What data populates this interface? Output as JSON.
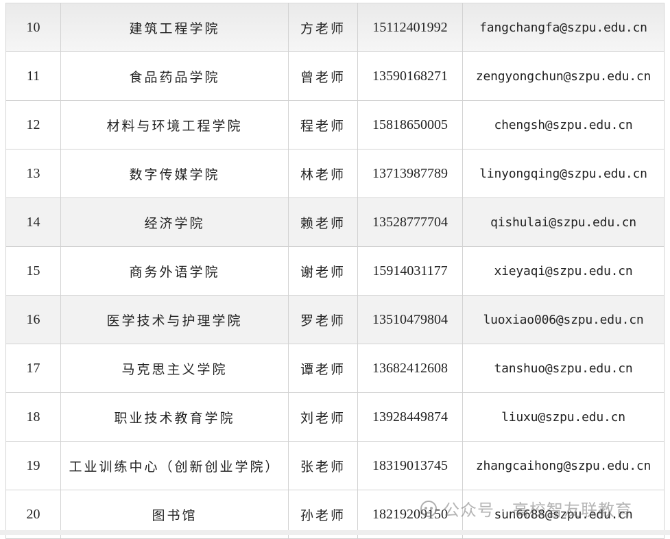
{
  "rows": [
    {
      "no": "10",
      "dept": "建筑工程学院",
      "contact": "方老师",
      "phone": "15112401992",
      "email": "fangchangfa@szpu.edu.cn"
    },
    {
      "no": "11",
      "dept": "食品药品学院",
      "contact": "曾老师",
      "phone": "13590168271",
      "email": "zengyongchun@szpu.edu.cn"
    },
    {
      "no": "12",
      "dept": "材料与环境工程学院",
      "contact": "程老师",
      "phone": "15818650005",
      "email": "chengsh@szpu.edu.cn"
    },
    {
      "no": "13",
      "dept": "数字传媒学院",
      "contact": "林老师",
      "phone": "13713987789",
      "email": "linyongqing@szpu.edu.cn"
    },
    {
      "no": "14",
      "dept": "经济学院",
      "contact": "赖老师",
      "phone": "13528777704",
      "email": "qishulai@szpu.edu.cn"
    },
    {
      "no": "15",
      "dept": "商务外语学院",
      "contact": "谢老师",
      "phone": "15914031177",
      "email": "xieyaqi@szpu.edu.cn"
    },
    {
      "no": "16",
      "dept": "医学技术与护理学院",
      "contact": "罗老师",
      "phone": "13510479804",
      "email": "luoxiao006@szpu.edu.cn"
    },
    {
      "no": "17",
      "dept": "马克思主义学院",
      "contact": "谭老师",
      "phone": "13682412608",
      "email": "tanshuo@szpu.edu.cn"
    },
    {
      "no": "18",
      "dept": "职业技术教育学院",
      "contact": "刘老师",
      "phone": "13928449874",
      "email": "liuxu@szpu.edu.cn"
    },
    {
      "no": "19",
      "dept": "工业训练中心（创新创业学院）",
      "contact": "张老师",
      "phone": "18319013745",
      "email": "zhangcaihong@szpu.edu.cn"
    },
    {
      "no": "20",
      "dept": "图书馆",
      "contact": "孙老师",
      "phone": "18219209150",
      "email": "sun6688@szpu.edu.cn"
    }
  ],
  "watermark": {
    "text": "公众号 · 高校智友联教育",
    "icon": "wechat-channel-icon"
  }
}
